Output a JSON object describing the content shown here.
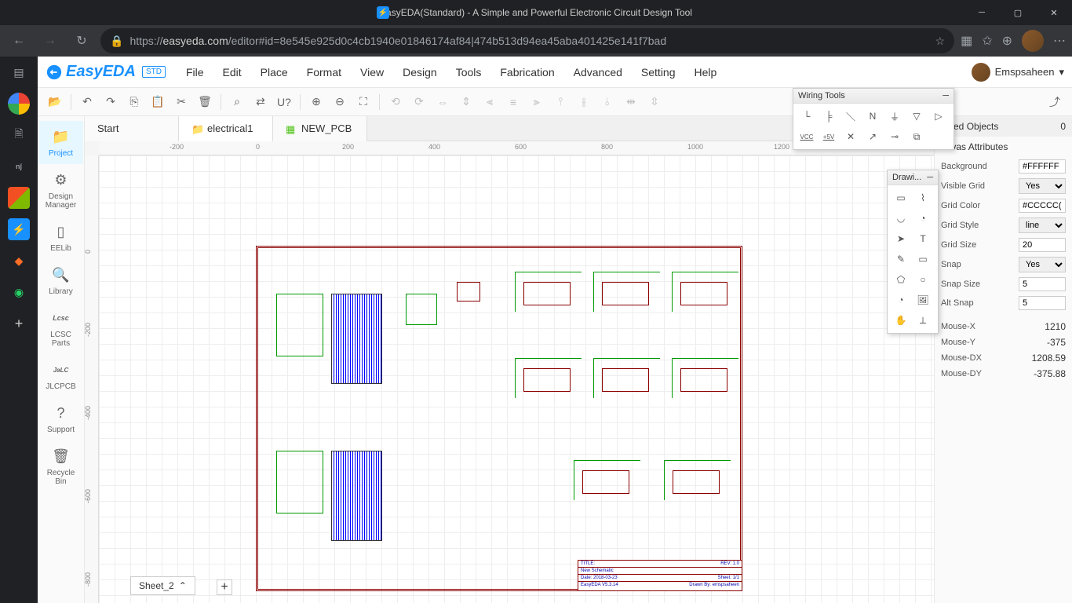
{
  "window": {
    "title": "EasyEDA(Standard) - A Simple and Powerful Electronic Circuit Design Tool"
  },
  "browser": {
    "url_proto": "https://",
    "url_host": "easyeda.com",
    "url_path": "/editor#id=8e545e925d0c4cb1940e01846174af84|474b513d94ea45aba401425e141f7bad"
  },
  "app": {
    "logo": "EasyEDA",
    "std": "STD",
    "user": "Emspsaheen"
  },
  "menu": [
    "File",
    "Edit",
    "Place",
    "Format",
    "View",
    "Design",
    "Tools",
    "Fabrication",
    "Advanced",
    "Setting",
    "Help"
  ],
  "sidebar": [
    {
      "label": "Project",
      "icon": "folder"
    },
    {
      "label": "Design Manager",
      "icon": "design"
    },
    {
      "label": "EELib",
      "icon": "chip"
    },
    {
      "label": "Library",
      "icon": "search"
    },
    {
      "label": "LCSC Parts",
      "icon": "lcsc"
    },
    {
      "label": "JLCPCB",
      "icon": "jlc"
    },
    {
      "label": "Support",
      "icon": "help"
    },
    {
      "label": "Recycle Bin",
      "icon": "trash"
    }
  ],
  "tabs": [
    {
      "label": "Start",
      "type": "start"
    },
    {
      "label": "electrical1",
      "type": "folder"
    },
    {
      "label": "NEW_PCB",
      "type": "pcb"
    }
  ],
  "ruler_h": [
    "-200",
    "0",
    "200",
    "400",
    "600",
    "800",
    "1000",
    "1200"
  ],
  "ruler_v": [
    "0",
    "-200",
    "-400",
    "-600",
    "-800"
  ],
  "sheet": {
    "current": "Sheet_2"
  },
  "titleblock": {
    "title_label": "TITLE:",
    "title": "New Schematic",
    "rev_label": "REV:",
    "rev": "1.0",
    "date_label": "Date:",
    "date": "2018-03-23",
    "sheet_label": "Sheet:",
    "sheet": "1/1",
    "tool": "EasyEDA V5.3.14",
    "drawn_label": "Drawn By:",
    "drawn": "emspsaheen"
  },
  "wiring_tools": {
    "title": "Wiring Tools"
  },
  "drawing_tools": {
    "title": "Drawi..."
  },
  "props": {
    "selected_label": "ected Objects",
    "selected_count": "0",
    "section": "anvas Attributes",
    "rows": [
      {
        "label": "Background",
        "value": "#FFFFFF",
        "type": "text"
      },
      {
        "label": "Visible Grid",
        "value": "Yes",
        "type": "select"
      },
      {
        "label": "Grid Color",
        "value": "#CCCCC(",
        "type": "text"
      },
      {
        "label": "Grid Style",
        "value": "line",
        "type": "select"
      },
      {
        "label": "Grid Size",
        "value": "20",
        "type": "text"
      },
      {
        "label": "Snap",
        "value": "Yes",
        "type": "select"
      },
      {
        "label": "Snap Size",
        "value": "5",
        "type": "text"
      },
      {
        "label": "Alt Snap",
        "value": "5",
        "type": "text"
      }
    ],
    "mouse": [
      {
        "label": "Mouse-X",
        "value": "1210"
      },
      {
        "label": "Mouse-Y",
        "value": "-375"
      },
      {
        "label": "Mouse-DX",
        "value": "1208.59"
      },
      {
        "label": "Mouse-DY",
        "value": "-375.88"
      }
    ]
  }
}
